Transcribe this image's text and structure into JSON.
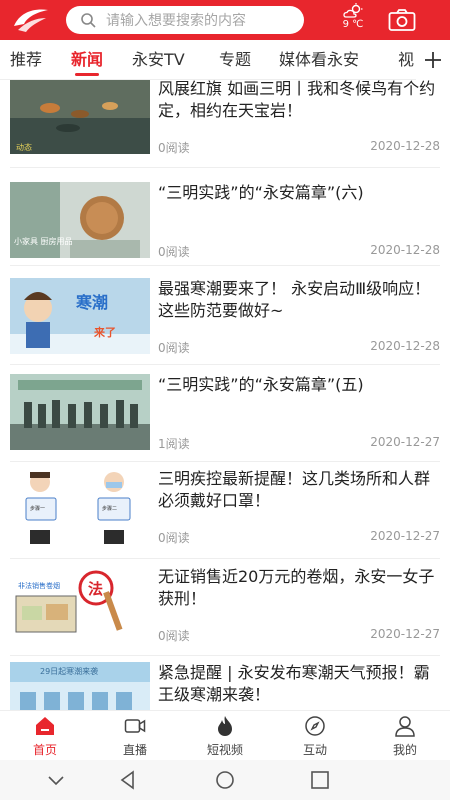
{
  "header": {
    "search_placeholder": "请输入想要搜索的内容",
    "weather_icon": "partly-cloudy-icon",
    "temperature": "9 ℃",
    "brand_color": "#e8262d"
  },
  "tabs": [
    {
      "label": "推荐",
      "active": false
    },
    {
      "label": "新闻",
      "active": true
    },
    {
      "label": "永安TV",
      "active": false
    },
    {
      "label": "专题",
      "active": false
    },
    {
      "label": "媒体看永安",
      "active": false
    },
    {
      "label": "视",
      "active": false
    }
  ],
  "feed": [
    {
      "title": "风展红旗 如画三明丨我和冬候鸟有个约定，相约在天宝岩！",
      "reads": "0阅读",
      "date": "2020-12-28"
    },
    {
      "title": "“三明实践”的“永安篇章”(六)",
      "reads": "0阅读",
      "date": "2020-12-28"
    },
    {
      "title": "最强寒潮要来了！ 永安启动Ⅲ级响应！这些防范要做好~",
      "reads": "0阅读",
      "date": "2020-12-28"
    },
    {
      "title": "“三明实践”的“永安篇章”(五)",
      "reads": "1阅读",
      "date": "2020-12-27"
    },
    {
      "title": "三明疾控最新提醒！这几类场所和人群必须戴好口罩！",
      "reads": "0阅读",
      "date": "2020-12-27"
    },
    {
      "title": "无证销售近20万元的卷烟，永安一女子获刑！",
      "reads": "0阅读",
      "date": "2020-12-27"
    },
    {
      "title": "紧急提醒 | 永安发布寒潮天气预报！霸王级寒潮来袭！",
      "reads": "",
      "date": ""
    }
  ],
  "thumb_text": {
    "t1": "动态",
    "t2": "小家具 厨房用品",
    "t3_a": "寒潮",
    "t3_b": "来了",
    "t5_a": "步骤一",
    "t5_b": "步骤二",
    "t6_a": "法",
    "t6_b": "非法销售卷烟",
    "t7": "29日起寒潮来袭"
  },
  "bottom_nav": [
    {
      "label": "首页",
      "icon": "home-icon",
      "active": true
    },
    {
      "label": "直播",
      "icon": "video-camera-icon",
      "active": false
    },
    {
      "label": "短视频",
      "icon": "flame-icon",
      "active": false
    },
    {
      "label": "互动",
      "icon": "compass-icon",
      "active": false
    },
    {
      "label": "我的",
      "icon": "user-icon",
      "active": false
    }
  ]
}
